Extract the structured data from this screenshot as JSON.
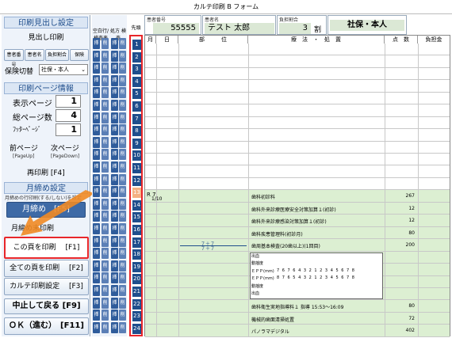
{
  "window": {
    "title": "カルテ印刷 B フォーム"
  },
  "left": {
    "header_section_title": "印刷見出し設定",
    "header_print_label": "見出し印刷",
    "tabs": [
      "患者番号",
      "患者名",
      "負担割合",
      "保険"
    ],
    "insurance_switch_label": "保険切替",
    "insurance_value": "社保・本人",
    "page_info_title": "印刷ページ情報",
    "display_page_label": "表示ページ",
    "display_page_value": "1",
    "total_pages_label": "総ページ数",
    "total_pages_value": "4",
    "footer_page_label": "ﾌｯﾀｰﾍﾟｰｼﾞ",
    "footer_page_value": "1",
    "prev_page": "前ページ",
    "prev_page_key": "[PageUp]",
    "next_page": "次ページ",
    "next_page_key": "[PageDown]",
    "reprint": "再印刷 [F4]",
    "closing_title": "月締め設定",
    "closing_desc": "月締めの行印刷(する/しない)を設定",
    "closing_button": "月締め　[F5]",
    "closing_end_button": "月締め末印刷",
    "print_page": "この頁を印刷　 [F1]",
    "print_all": "全ての頁を印刷　 [F2]",
    "karte_settings": "カルテ印刷設定　 [F3]",
    "cancel": "中止して戻る [F9]",
    "ok": "ＯＫ（進む）　[F11]"
  },
  "colA": {
    "title": "空白行/ 検査表",
    "items": [
      "挿",
      "削"
    ]
  },
  "colB": {
    "title": "処方 検査",
    "items": [
      "挿",
      "削"
    ]
  },
  "num_col": {
    "title": "先頭",
    "numbers": [
      "1",
      "2",
      "3",
      "4",
      "5",
      "6",
      "7",
      "8",
      "9",
      "10",
      "11",
      "12",
      "13",
      "14",
      "15",
      "16",
      "17",
      "18",
      "19",
      "20",
      "21",
      "22",
      "23",
      "24"
    ]
  },
  "header": {
    "patient_no_label": "患者番号",
    "patient_no": "55555",
    "patient_name_label": "患者名",
    "patient_name": "テスト 太郎",
    "burden_label": "負担割合",
    "burden": "3",
    "burden_unit": "割",
    "insurance": "社保・本人"
  },
  "grid": {
    "columns": [
      "月",
      "日",
      "部　　　位",
      "療　法　・　処　置",
      "点　数",
      "負担金"
    ],
    "date": "R 7",
    "date2": "1/10",
    "bills": [
      {
        "name": "歯科初診料",
        "points": "267"
      },
      {
        "name": "歯科外来診療医療安全対策加算１(初診)",
        "points": "12"
      },
      {
        "name": "歯科外来診療感染対策加算１(初診)",
        "points": "12"
      },
      {
        "name": "歯科疾患管理料(初診月)",
        "points": "80"
      },
      {
        "name": "歯周基本検査(20歯以上)(1回目)",
        "points": "200"
      },
      {
        "name": "歯科衛生実地指導料１ 指導 15:53～16:09",
        "points": "80"
      },
      {
        "name": "機械的歯面清掃処置",
        "points": "72"
      },
      {
        "name": "パノラマデジタル",
        "points": "402"
      }
    ],
    "teeth_upper": "７＋７",
    "teeth_lower": "７＋７",
    "perio_labels": [
      "出血",
      "動揺度",
      "ＥＰＰ(mm)",
      "ＥＰＰ(mm)",
      "動揺度",
      "出血"
    ],
    "perio_row1": "7 6 7 6 4 3 2 1 2 3 4 5 6 7 8",
    "perio_row2": "8 7 6 5 4 3 2 1 2 3 4 5 6 7 8"
  }
}
